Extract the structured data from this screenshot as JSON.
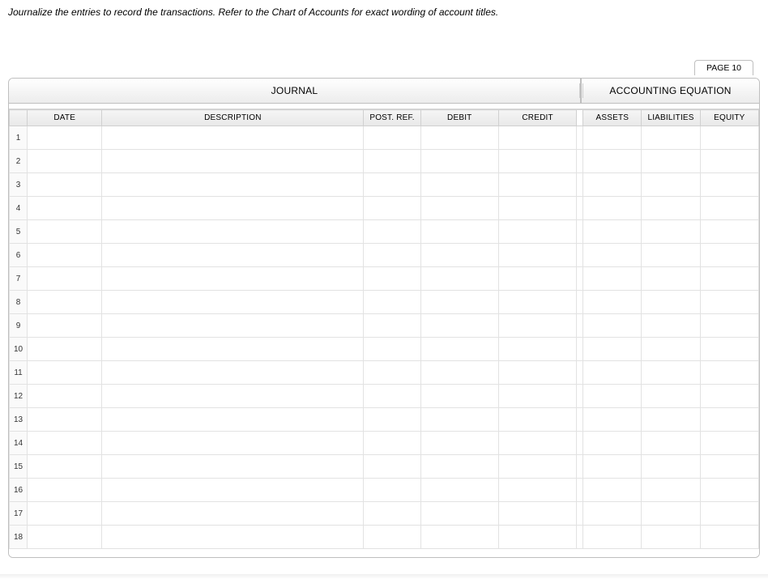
{
  "instruction": "Journalize the entries to record the transactions. Refer to the Chart of Accounts for exact wording of account titles.",
  "page_tab": "PAGE 10",
  "sections": {
    "journal": "JOURNAL",
    "accounting_equation": "ACCOUNTING EQUATION"
  },
  "columns": {
    "num": "",
    "date": "DATE",
    "description": "DESCRIPTION",
    "post_ref": "POST. REF.",
    "debit": "DEBIT",
    "credit": "CREDIT",
    "assets": "ASSETS",
    "liabilities": "LIABILITIES",
    "equity": "EQUITY"
  },
  "rows": [
    {
      "n": "1",
      "date": "",
      "description": "",
      "post_ref": "",
      "debit": "",
      "credit": "",
      "assets": "",
      "liabilities": "",
      "equity": ""
    },
    {
      "n": "2",
      "date": "",
      "description": "",
      "post_ref": "",
      "debit": "",
      "credit": "",
      "assets": "",
      "liabilities": "",
      "equity": ""
    },
    {
      "n": "3",
      "date": "",
      "description": "",
      "post_ref": "",
      "debit": "",
      "credit": "",
      "assets": "",
      "liabilities": "",
      "equity": ""
    },
    {
      "n": "4",
      "date": "",
      "description": "",
      "post_ref": "",
      "debit": "",
      "credit": "",
      "assets": "",
      "liabilities": "",
      "equity": ""
    },
    {
      "n": "5",
      "date": "",
      "description": "",
      "post_ref": "",
      "debit": "",
      "credit": "",
      "assets": "",
      "liabilities": "",
      "equity": ""
    },
    {
      "n": "6",
      "date": "",
      "description": "",
      "post_ref": "",
      "debit": "",
      "credit": "",
      "assets": "",
      "liabilities": "",
      "equity": ""
    },
    {
      "n": "7",
      "date": "",
      "description": "",
      "post_ref": "",
      "debit": "",
      "credit": "",
      "assets": "",
      "liabilities": "",
      "equity": ""
    },
    {
      "n": "8",
      "date": "",
      "description": "",
      "post_ref": "",
      "debit": "",
      "credit": "",
      "assets": "",
      "liabilities": "",
      "equity": ""
    },
    {
      "n": "9",
      "date": "",
      "description": "",
      "post_ref": "",
      "debit": "",
      "credit": "",
      "assets": "",
      "liabilities": "",
      "equity": ""
    },
    {
      "n": "10",
      "date": "",
      "description": "",
      "post_ref": "",
      "debit": "",
      "credit": "",
      "assets": "",
      "liabilities": "",
      "equity": ""
    },
    {
      "n": "11",
      "date": "",
      "description": "",
      "post_ref": "",
      "debit": "",
      "credit": "",
      "assets": "",
      "liabilities": "",
      "equity": ""
    },
    {
      "n": "12",
      "date": "",
      "description": "",
      "post_ref": "",
      "debit": "",
      "credit": "",
      "assets": "",
      "liabilities": "",
      "equity": ""
    },
    {
      "n": "13",
      "date": "",
      "description": "",
      "post_ref": "",
      "debit": "",
      "credit": "",
      "assets": "",
      "liabilities": "",
      "equity": ""
    },
    {
      "n": "14",
      "date": "",
      "description": "",
      "post_ref": "",
      "debit": "",
      "credit": "",
      "assets": "",
      "liabilities": "",
      "equity": ""
    },
    {
      "n": "15",
      "date": "",
      "description": "",
      "post_ref": "",
      "debit": "",
      "credit": "",
      "assets": "",
      "liabilities": "",
      "equity": ""
    },
    {
      "n": "16",
      "date": "",
      "description": "",
      "post_ref": "",
      "debit": "",
      "credit": "",
      "assets": "",
      "liabilities": "",
      "equity": ""
    },
    {
      "n": "17",
      "date": "",
      "description": "",
      "post_ref": "",
      "debit": "",
      "credit": "",
      "assets": "",
      "liabilities": "",
      "equity": ""
    },
    {
      "n": "18",
      "date": "",
      "description": "",
      "post_ref": "",
      "debit": "",
      "credit": "",
      "assets": "",
      "liabilities": "",
      "equity": ""
    }
  ]
}
